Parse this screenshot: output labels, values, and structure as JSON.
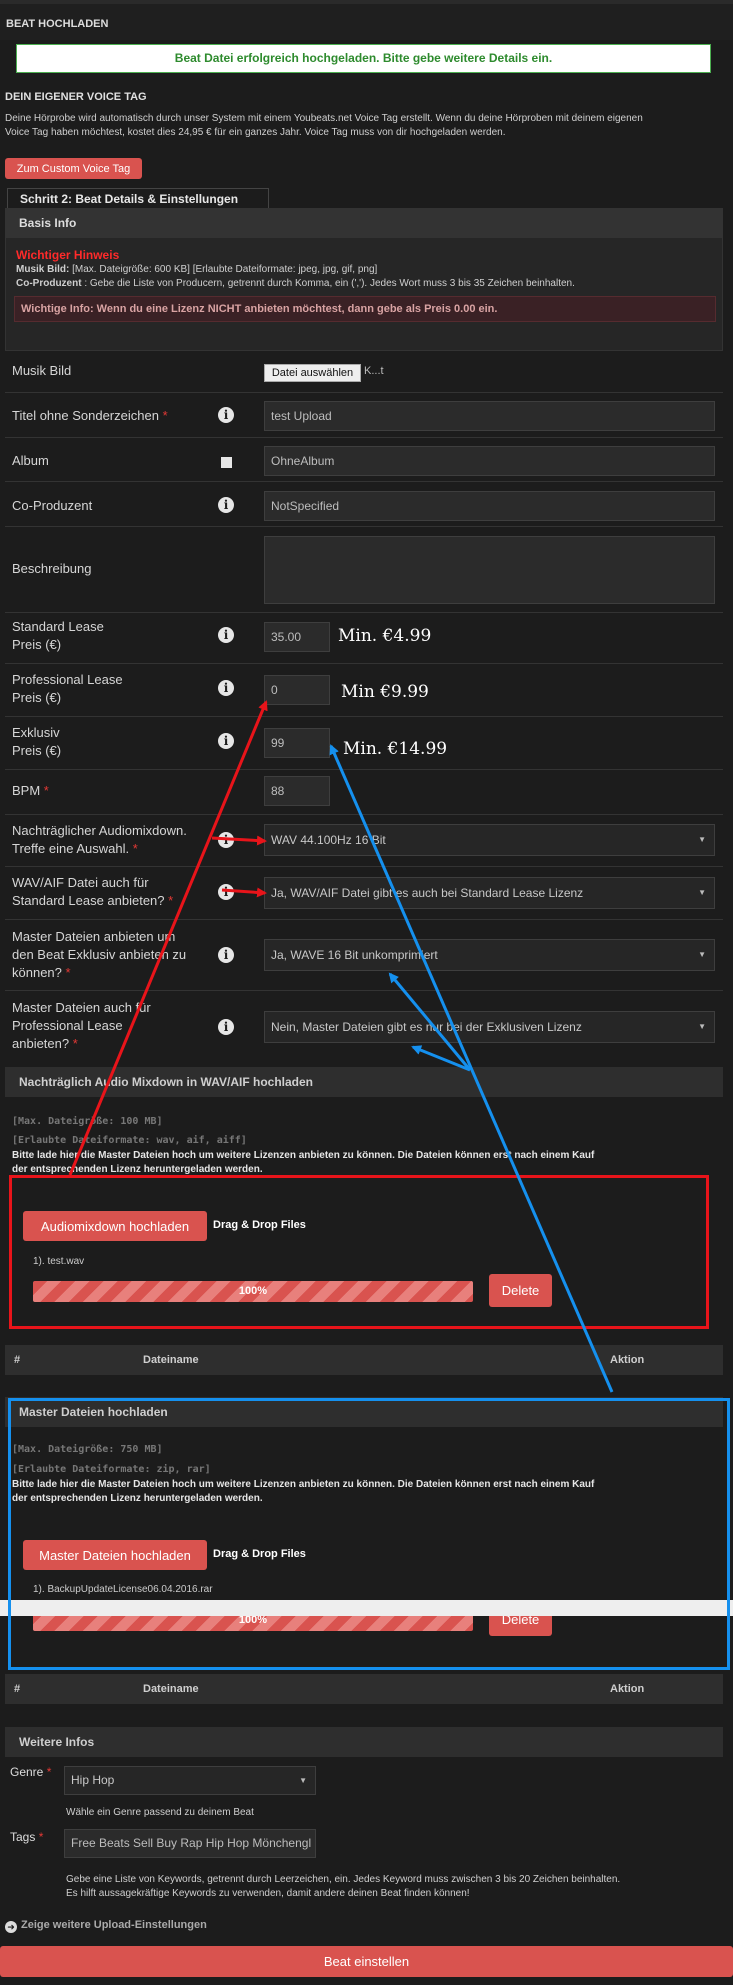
{
  "header": {
    "title": "BEAT HOCHLADEN"
  },
  "success_message": "Beat Datei erfolgreich hochgeladen. Bitte gebe weitere Details ein.",
  "voice_tag": {
    "heading": "DEIN EIGENER VOICE TAG",
    "text_line1": "Deine Hörprobe wird automatisch durch unser System mit einem Youbeats.net Voice Tag erstellt. Wenn du deine Hörproben mit deinem eigenen",
    "text_line2": "Voice Tag haben möchtest, kostet dies 24,95 € für ein ganzes Jahr. Voice Tag muss von dir hochgeladen werden.",
    "button": "Zum Custom Voice Tag"
  },
  "tab_label": "Schritt 2: Beat Details & Einstellungen",
  "basis": {
    "heading": "Basis Info",
    "hint_title": "Wichtiger Hinweis",
    "hint_line1_bold": "Musik Bild:",
    "hint_line1": " [Max. Dateigröße: 600 KB] [Erlaubte Dateiformate: jpeg, jpg, gif, png]",
    "hint_line2_bold": "Co-Produzent",
    "hint_line2": " : Gebe die Liste von Producern, getrennt durch Komma, ein (','). Jedes Wort muss 3 bis 35 Zeichen beinhalten.",
    "warning": "Wichtige Info: Wenn du eine Lizenz NICHT anbieten möchtest, dann gebe als Preis 0.00 ein."
  },
  "form": {
    "musik_bild": {
      "label": "Musik Bild",
      "button": "Datei auswählen",
      "file": "K...t"
    },
    "titel": {
      "label": "Titel ohne Sonderzeichen",
      "req": "*",
      "value": "test Upload"
    },
    "album": {
      "label": "Album",
      "value": "OhneAlbum"
    },
    "co_produzent": {
      "label": "Co-Produzent",
      "value": "NotSpecified"
    },
    "beschreibung": {
      "label": "Beschreibung",
      "value": ""
    },
    "standard": {
      "label1": "Standard Lease",
      "label2": "Preis (€)",
      "value": "35.00",
      "min": "Min. €4.99"
    },
    "professional": {
      "label1": "Professional Lease",
      "label2": "Preis (€)",
      "value": "0",
      "min": "Min €9.99"
    },
    "exklusiv": {
      "label1": "Exklusiv",
      "label2": "Preis (€)",
      "value": "99",
      "min": "Min. €14.99"
    },
    "bpm": {
      "label": "BPM",
      "req": "*",
      "value": "88"
    },
    "mixdown": {
      "label1": "Nachträglicher Audiomixdown.",
      "label2": "Treffe eine Auswahl.",
      "req": "*",
      "value": "WAV 44.100Hz 16 Bit"
    },
    "wav_aif": {
      "label1": "WAV/AIF Datei auch für",
      "label2": "Standard Lease anbieten?",
      "req": "*",
      "value": "Ja, WAV/AIF Datei gibt es auch bei Standard Lease Lizenz"
    },
    "master_exklusiv": {
      "label1": "Master Dateien anbieten um",
      "label2": "den Beat Exklusiv anbieten zu",
      "label3": "können?",
      "req": "*",
      "value": "Ja, WAVE 16 Bit unkomprimiert"
    },
    "master_prof": {
      "label1": "Master Dateien auch für",
      "label2": "Professional Lease",
      "label3": "anbieten?",
      "req": "*",
      "value": "Nein, Master Dateien gibt es nur bei der Exklusiven Lizenz"
    }
  },
  "mixdown_upload": {
    "heading": "Nachträglich Audio Mixdown in WAV/AIF hochladen",
    "max": "[Max. Dateigröße: 100 MB]",
    "formats": "[Erlaubte Dateiformate: wav, aif, aiff]",
    "note_line1": "Bitte lade hier die Master Dateien hoch um weitere Lizenzen anbieten zu können. Die Dateien können erst nach einem Kauf",
    "note_line2": "der entsprechenden Lizenz heruntergeladen werden.",
    "button": "Audiomixdown hochladen",
    "dragdrop": "Drag & Drop Files",
    "file": "1). test.wav",
    "progress": "100%",
    "delete": "Delete",
    "col_num": "#",
    "col_name": "Dateiname",
    "col_action": "Aktion"
  },
  "master_upload": {
    "heading": "Master Dateien hochladen",
    "max": "[Max. Dateigröße: 750 MB]",
    "formats": "[Erlaubte Dateiformate: zip, rar]",
    "note_line1": "Bitte lade hier die Master Dateien hoch um weitere Lizenzen anbieten zu können. Die Dateien können erst nach einem Kauf",
    "note_line2": "der entsprechenden Lizenz heruntergeladen werden.",
    "button": "Master Dateien hochladen",
    "dragdrop": "Drag & Drop Files",
    "file": "1). BackupUpdateLicense06.04.2016.rar",
    "progress": "100%",
    "delete": "Delete",
    "col_num": "#",
    "col_name": "Dateiname",
    "col_action": "Aktion"
  },
  "weitere": {
    "heading": "Weitere Infos",
    "genre_label": "Genre",
    "genre_req": "*",
    "genre_value": "Hip Hop",
    "genre_help": "Wähle ein Genre passend zu deinem Beat",
    "tags_label": "Tags",
    "tags_req": "*",
    "tags_value": "Free Beats Sell Buy Rap Hip Hop Mönchengl",
    "tags_help1": "Gebe eine Liste von Keywords, getrennt durch Leerzeichen, ein. Jedes Keyword muss zwischen 3 bis 20 Zeichen beinhalten.",
    "tags_help2": "Es hilft aussagekräftige Keywords zu verwenden, damit andere deinen Beat finden können!"
  },
  "more_settings": "Zeige weitere Upload-Einstellungen",
  "submit": "Beat einstellen",
  "annotation_colors": {
    "red": "#e8141a",
    "blue": "#1590ee"
  }
}
